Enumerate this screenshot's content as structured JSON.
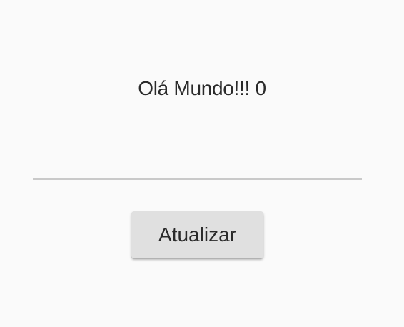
{
  "main": {
    "greeting_text": "Olá Mundo!!! 0",
    "input": {
      "value": "",
      "placeholder": ""
    },
    "update_button_label": "Atualizar"
  }
}
